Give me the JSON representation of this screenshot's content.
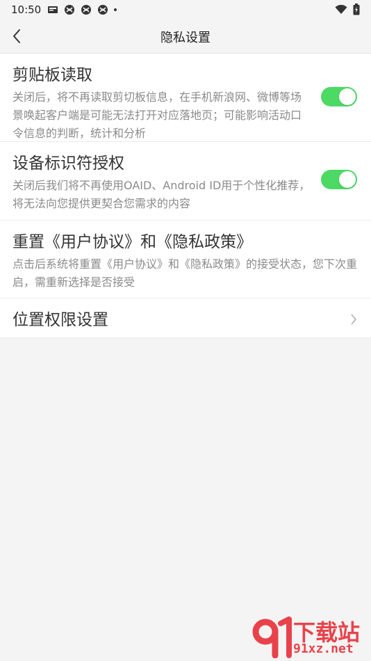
{
  "status_bar": {
    "time": "10:50"
  },
  "header": {
    "title": "隐私设置"
  },
  "settings": [
    {
      "title": "剪贴板读取",
      "description": "关闭后，将不再读取剪切板信息，在手机新浪网、微博等场景唤起客户端是可能无法打开对应落地页；可能影响活动口令信息的判断，统计和分析",
      "toggle_on": true
    },
    {
      "title": "设备标识符授权",
      "description": "关闭后我们将不再使用OAID、Android ID用于个性化推荐，将无法向您提供更契合您需求的内容",
      "toggle_on": true
    },
    {
      "title": "重置《用户协议》和《隐私政策》",
      "description": "点击后系统将重置《用户协议》和《隐私政策》的接受状态，您下次重启，需重新选择是否接受"
    },
    {
      "title": "位置权限设置"
    }
  ],
  "watermark": {
    "text": "下载站",
    "domain": "91xz.net"
  },
  "colors": {
    "toggle_on": "#4cd964",
    "text_primary": "#333333",
    "text_secondary": "#8a8a8a",
    "watermark_red": "#e8434b"
  }
}
